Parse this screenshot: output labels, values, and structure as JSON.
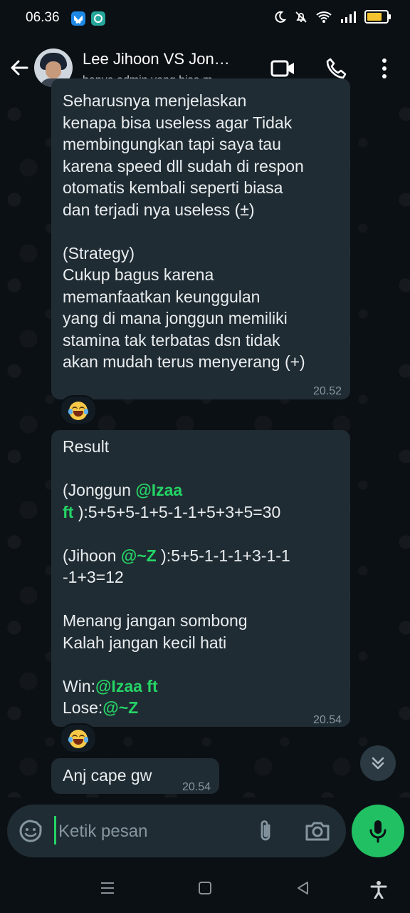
{
  "status_bar": {
    "time": "06.36",
    "icons": [
      "bluesky-icon",
      "chat-app-icon",
      "moon-icon",
      "mute-bell-icon",
      "wifi-icon",
      "signal-icon",
      "battery-icon"
    ]
  },
  "header": {
    "title": "Lee Jihoon VS Jon…",
    "subtitle": "hanya admin yang bisa m…",
    "icons": [
      "back-arrow-icon",
      "video-call-icon",
      "phone-icon",
      "more-vert-icon"
    ]
  },
  "messages": [
    {
      "id": "m1",
      "lines": "Seharusnya menjelaskan\nkenapa bisa useless agar Tidak\nmembingungkan tapi saya tau\nkarena speed dll sudah di respon\notomatis kembali seperti biasa\ndan terjadi nya useless (±)\n\n(Strategy)\nCukup bagus karena\nmemanfaatkan keunggulan\nyang di mana jonggun memiliki\nstamina tak terbatas dsn tidak\nakan mudah terus menyerang (+)",
      "time": "20.52",
      "reaction": "laughing-tears-emoji"
    },
    {
      "id": "m2",
      "result_label": "Result",
      "jonggun_prefix": "(Jonggun ",
      "jonggun_mention_a": "@Izaa",
      "jonggun_mention_b": "ft",
      "jonggun_score": " ):5+5+5-1+5-1-1+5+3+5=30",
      "jihoon_prefix": "(Jihoon ",
      "jihoon_mention": "@~Z",
      "jihoon_score_a": " ):5+5-1-1-1+3-1-1",
      "jihoon_score_b": "-1+3=12",
      "motto_a": "Menang jangan sombong",
      "motto_b": "Kalah jangan kecil hati",
      "win_label": "Win:",
      "win_mention": "@Izaa ft",
      "lose_label": "Lose:",
      "lose_mention": "@~Z",
      "time": "20.54",
      "reaction": "laughing-tears-emoji"
    },
    {
      "id": "m3",
      "text": "Anj cape gw",
      "time": "20.54"
    }
  ],
  "composer": {
    "placeholder": "Ketik pesan",
    "icons": [
      "sticker-icon",
      "attach-icon",
      "camera-icon",
      "mic-icon"
    ]
  },
  "nav": [
    "recents-icon",
    "home-icon",
    "back-icon",
    "accessibility-icon"
  ],
  "colors": {
    "background": "#0b1014",
    "bubble": "#202c33",
    "mention": "#25d366",
    "accent": "#21c063",
    "timestamp": "#8696a0"
  }
}
